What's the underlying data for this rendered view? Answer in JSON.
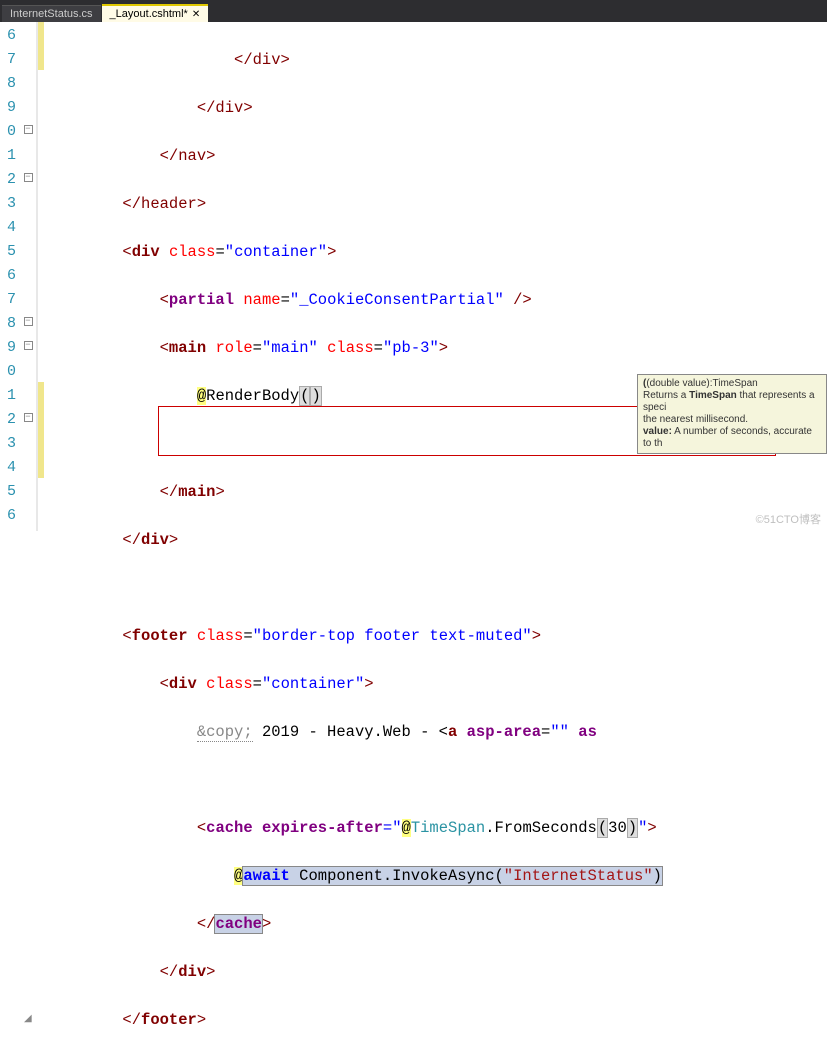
{
  "tabs": {
    "inactive": "InternetStatus.cs",
    "active": "_Layout.cshtml*",
    "close_glyph": "✕"
  },
  "gutter": [
    "6",
    "7",
    "8",
    "9",
    "0",
    "1",
    "2",
    "3",
    "4",
    "5",
    "6",
    "7",
    "8",
    "9",
    "0",
    "1",
    "2",
    "3",
    "4",
    "5",
    "6"
  ],
  "code": {
    "l6": "                    </div>",
    "l7": "                </div>",
    "l8": "            </nav>",
    "l9": "        </header>",
    "l10a": "        <",
    "l10tag": "div",
    "l10b": " ",
    "l10attr": "class",
    "l10c": "=",
    "l10str": "\"container\"",
    "l10d": ">",
    "l11a": "            <",
    "l11tag": "partial",
    "l11b": " ",
    "l11attr": "name",
    "l11c": "=",
    "l11str": "\"_CookieConsentPartial\"",
    "l11d": " />",
    "l12a": "            <",
    "l12tag": "main",
    "l12b": " ",
    "l12attr1": "role",
    "l12c": "=",
    "l12str1": "\"main\"",
    "l12d": " ",
    "l12attr2": "class",
    "l12e": "=",
    "l12str2": "\"pb-3\"",
    "l12f": ">",
    "l13a": "                ",
    "l13at": "@",
    "l13b": "RenderBody",
    "l13c": "(",
    "l13d": ")",
    "l14": "",
    "l15a": "            </",
    "l15tag": "main",
    "l15b": ">",
    "l16a": "        </",
    "l16tag": "div",
    "l16b": ">",
    "l17": "",
    "l18a": "        <",
    "l18tag": "footer",
    "l18b": " ",
    "l18attr": "class",
    "l18c": "=",
    "l18str": "\"border-top footer text-muted\"",
    "l18d": ">",
    "l19a": "            <",
    "l19tag": "div",
    "l19b": " ",
    "l19attr": "class",
    "l19c": "=",
    "l19str": "\"container\"",
    "l19d": ">",
    "l20a": "                ",
    "l20ent": "&copy;",
    "l20b": " 2019 - Heavy.Web - <",
    "l20tag": "a",
    "l20c": " ",
    "l20attr1": "asp-area",
    "l20d": "=",
    "l20str1": "\"\"",
    "l20e": " ",
    "l20attr2": "as",
    "l21": "",
    "l22a": "                <",
    "l22tag": "cache",
    "l22b": " ",
    "l22attr": "expires-after",
    "l22c": "=\"",
    "l22at": "@",
    "l22type": "TimeSpan",
    "l22d": ".FromSeconds",
    "l22e": "(",
    "l22num": "30",
    "l22f": ")",
    "l22g": "\"",
    "l22h": ">",
    "l23a": "                    ",
    "l23at": "@",
    "l23kw": "await",
    "l23b": " Component.InvokeAsync(",
    "l23str": "\"InternetStatus\"",
    "l23c": ")",
    "l24a": "                </",
    "l24tag": "cache",
    "l24b": ">",
    "l25a": "            </",
    "l25tag": "div",
    "l25b": ">",
    "l26a": "        </",
    "l26tag": "footer",
    "l26b": ">"
  },
  "tooltip": {
    "sig": "(double value):TimeSpan",
    "line1a": "Returns a ",
    "line1b": "TimeSpan",
    "line1c": " that represents a speci",
    "line2": "the nearest millisecond.",
    "line3a": "value:",
    "line3b": " A number of seconds, accurate to th"
  },
  "watermark": "©51CTO博客"
}
